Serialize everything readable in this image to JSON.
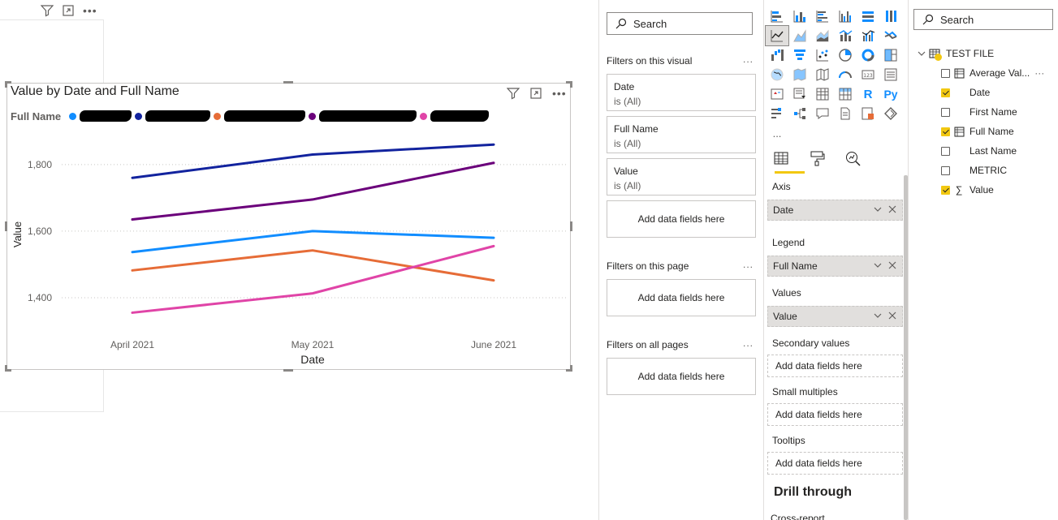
{
  "visual": {
    "title": "Value by Date and Full Name",
    "legend_title": "Full Name",
    "legend_items": [
      {
        "color": "#118DFF"
      },
      {
        "color": "#12239E"
      },
      {
        "color": "#E66C37"
      },
      {
        "color": "#6B007B"
      },
      {
        "color": "#E044A7"
      }
    ]
  },
  "chart_data": {
    "type": "line",
    "title": "Value by Date and Full Name",
    "xlabel": "Date",
    "ylabel": "Value",
    "categories": [
      "April 2021",
      "May 2021",
      "June 2021"
    ],
    "y_ticks": [
      "1,400",
      "1,600",
      "1,800"
    ],
    "ylim": [
      1300,
      1880
    ],
    "grid": "horizontal dotted",
    "legend_position": "top-left",
    "series": [
      {
        "color": "#12239E",
        "values": [
          1760,
          1830,
          1860
        ]
      },
      {
        "color": "#6B007B",
        "values": [
          1635,
          1695,
          1805
        ]
      },
      {
        "color": "#118DFF",
        "values": [
          1537,
          1600,
          1580
        ]
      },
      {
        "color": "#E66C37",
        "values": [
          1482,
          1542,
          1452
        ]
      },
      {
        "color": "#E044A7",
        "values": [
          1355,
          1413,
          1555
        ]
      }
    ]
  },
  "filters": {
    "search_placeholder": "Search",
    "on_visual_label": "Filters on this visual",
    "visual_filters": [
      {
        "field": "Date",
        "state": "is (All)"
      },
      {
        "field": "Full Name",
        "state": "is (All)"
      },
      {
        "field": "Value",
        "state": "is (All)"
      }
    ],
    "add_fields": "Add data fields here",
    "on_page_label": "Filters on this page",
    "on_all_label": "Filters on all pages",
    "more": "..."
  },
  "viz": {
    "more": "...",
    "axis_label": "Axis",
    "axis_field": "Date",
    "legend_label": "Legend",
    "legend_field": "Full Name",
    "values_label": "Values",
    "values_field": "Value",
    "secondary_label": "Secondary values",
    "small_multiples_label": "Small multiples",
    "tooltips_label": "Tooltips",
    "add_fields": "Add data fields here",
    "drill_through": "Drill through",
    "cross_report": "Cross-report",
    "r_label": "R",
    "py_label": "Py"
  },
  "fields": {
    "search_placeholder": "Search",
    "table_name": "TEST FILE",
    "items": [
      {
        "name": "Average Val...",
        "checked": false,
        "icon": "measure-icon"
      },
      {
        "name": "Date",
        "checked": true,
        "icon": "none"
      },
      {
        "name": "First Name",
        "checked": false,
        "icon": "none"
      },
      {
        "name": "Full Name",
        "checked": true,
        "icon": "table-icon"
      },
      {
        "name": "Last Name",
        "checked": false,
        "icon": "none"
      },
      {
        "name": "METRIC",
        "checked": false,
        "icon": "none"
      },
      {
        "name": "Value",
        "checked": true,
        "icon": "sigma-icon"
      }
    ],
    "sigma": "∑"
  }
}
